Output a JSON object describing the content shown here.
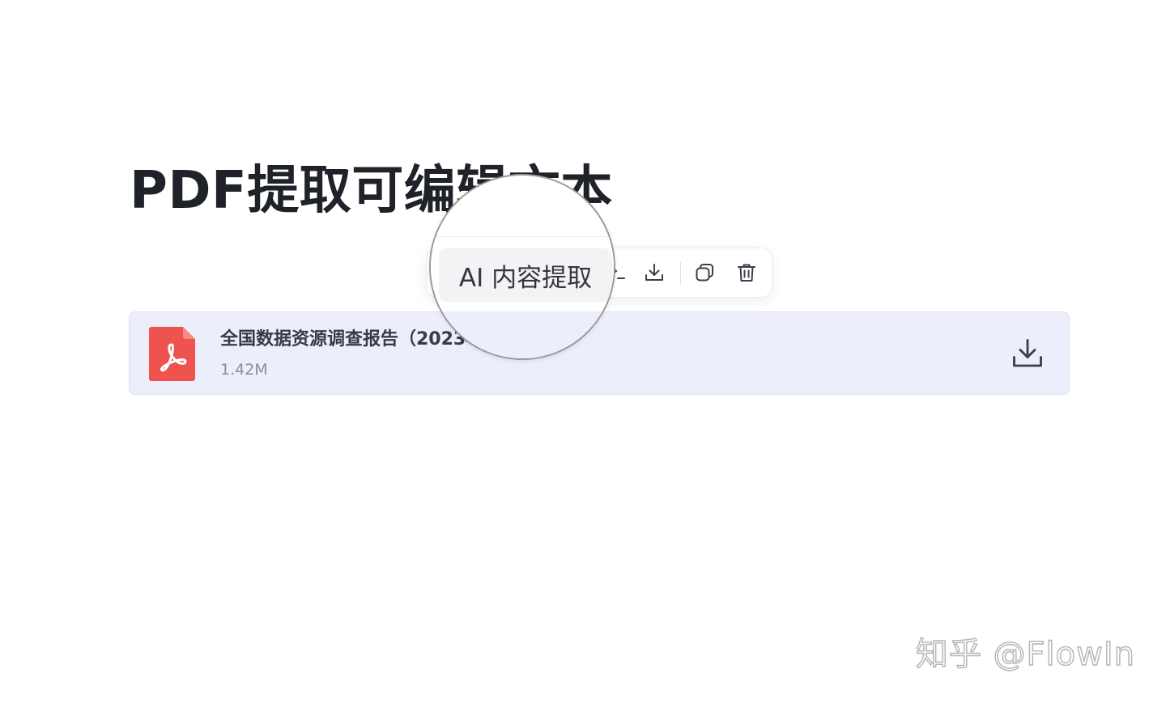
{
  "page": {
    "title": "PDF提取可编辑文本"
  },
  "toolbar": {
    "ai_extract_label": "AI 内容提取",
    "icons": [
      "partial-icon",
      "download-icon",
      "copy-icon",
      "trash-icon"
    ]
  },
  "attachment": {
    "file_name": "全国数据资源调查报告（2023年）",
    "file_size": "1.42M",
    "file_type_icon": "pdf-icon",
    "accent_color": "#ef5350",
    "background": "#eceefb"
  },
  "watermark": {
    "text": "知乎 @FlowIn"
  }
}
